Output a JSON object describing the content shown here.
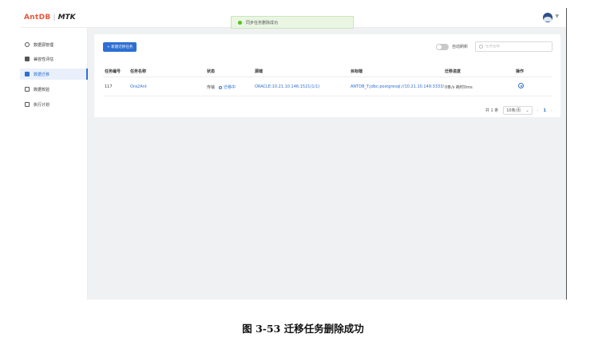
{
  "header": {
    "brand": "AntDB",
    "divider": "|",
    "product": "MTK"
  },
  "toast": {
    "message": "同步任务删除成功",
    "color": "#52c41a"
  },
  "sidebar": {
    "items": [
      {
        "label": "数据源管理",
        "icon": "database-icon"
      },
      {
        "label": "兼容性评估",
        "icon": "document-icon"
      },
      {
        "label": "数据迁移",
        "icon": "folder-icon",
        "active": true
      },
      {
        "label": "数据校验",
        "icon": "check-icon"
      },
      {
        "label": "执行计划",
        "icon": "calendar-icon"
      }
    ]
  },
  "toolbar": {
    "add_label": "+ 新建迁移任务",
    "auto_refresh_label": "自动刷新",
    "search_placeholder": "任务名称"
  },
  "table": {
    "columns": [
      "任务编号",
      "任务名称",
      "状态",
      "源端",
      "目标端",
      "迁移进度",
      "操作"
    ],
    "rows": [
      {
        "id": "117",
        "name": "Ora2Ant",
        "state_label": "传输",
        "state_value": "迁移中",
        "source": "ORACLE:10.21.10.146:1521(1/1)",
        "target": "ANTDB_T:jdbc:postgresql://10.21.10.149:3333/",
        "progress": "0条/s  耗时0ms"
      }
    ]
  },
  "pagination": {
    "total": "共 1 条",
    "page_size": "10条/页",
    "prev": "‹",
    "current": "1",
    "next": "›"
  },
  "caption": "图 3-53  迁移任务删除成功",
  "colors": {
    "accent": "#2d6fd3",
    "brand": "#e8553d",
    "success": "#52c41a"
  }
}
